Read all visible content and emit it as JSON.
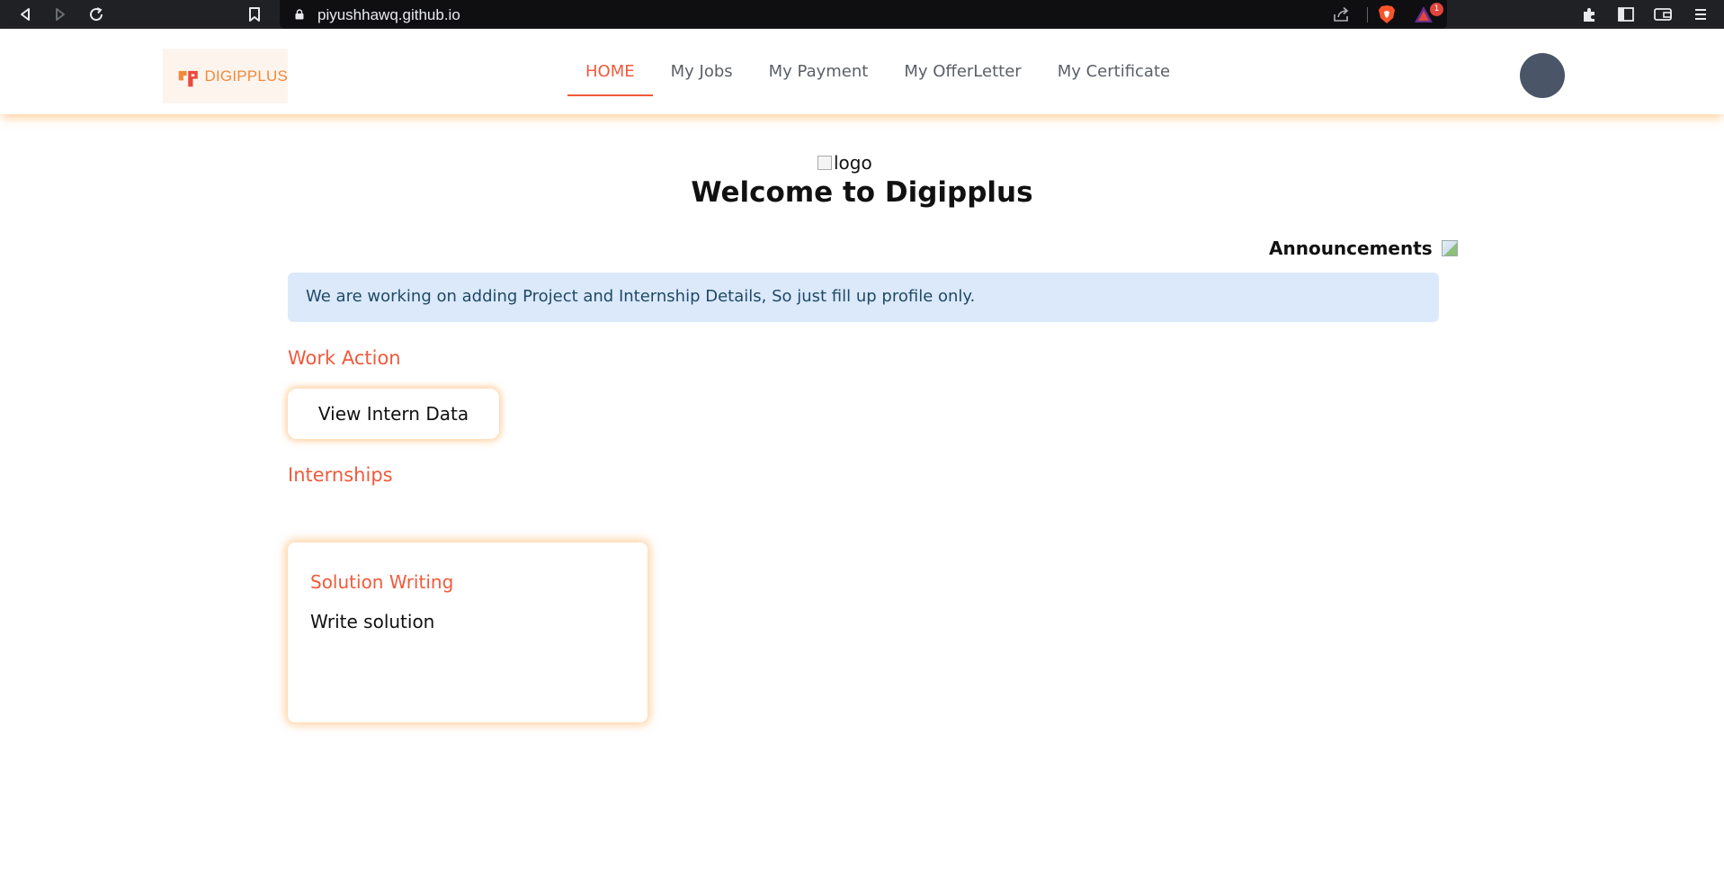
{
  "browser": {
    "url": "piyushhawq.github.io",
    "rewards_badge": "1",
    "icons": [
      "back-icon",
      "forward-icon",
      "reload-icon",
      "bookmark-icon",
      "lock-icon",
      "share-icon",
      "brave-shields-icon",
      "brave-rewards-icon",
      "extensions-icon",
      "sidebar-icon",
      "wallet-icon",
      "menu-icon"
    ]
  },
  "header": {
    "brand": "DIGIPPLUS",
    "nav": [
      {
        "label": "HOME",
        "active": true
      },
      {
        "label": "My Jobs",
        "active": false
      },
      {
        "label": "My Payment",
        "active": false
      },
      {
        "label": "My OfferLetter",
        "active": false
      },
      {
        "label": "My Certificate",
        "active": false
      }
    ]
  },
  "main": {
    "logo_alt": "logo",
    "welcome": "Welcome to Digipplus",
    "announcements_label": "Announcements",
    "alert": "We are working on adding Project and Internship Details, So just fill up profile only.",
    "work_action_title": "Work Action",
    "view_intern_button": "View Intern Data",
    "internships_title": "Internships",
    "internship_card": {
      "title": "Solution Writing",
      "description": "Write solution"
    }
  },
  "colors": {
    "accent": "#f05a3c",
    "alert_bg": "#dbe9fb",
    "avatar": "#4a5568",
    "glow": "#ffaa50"
  }
}
